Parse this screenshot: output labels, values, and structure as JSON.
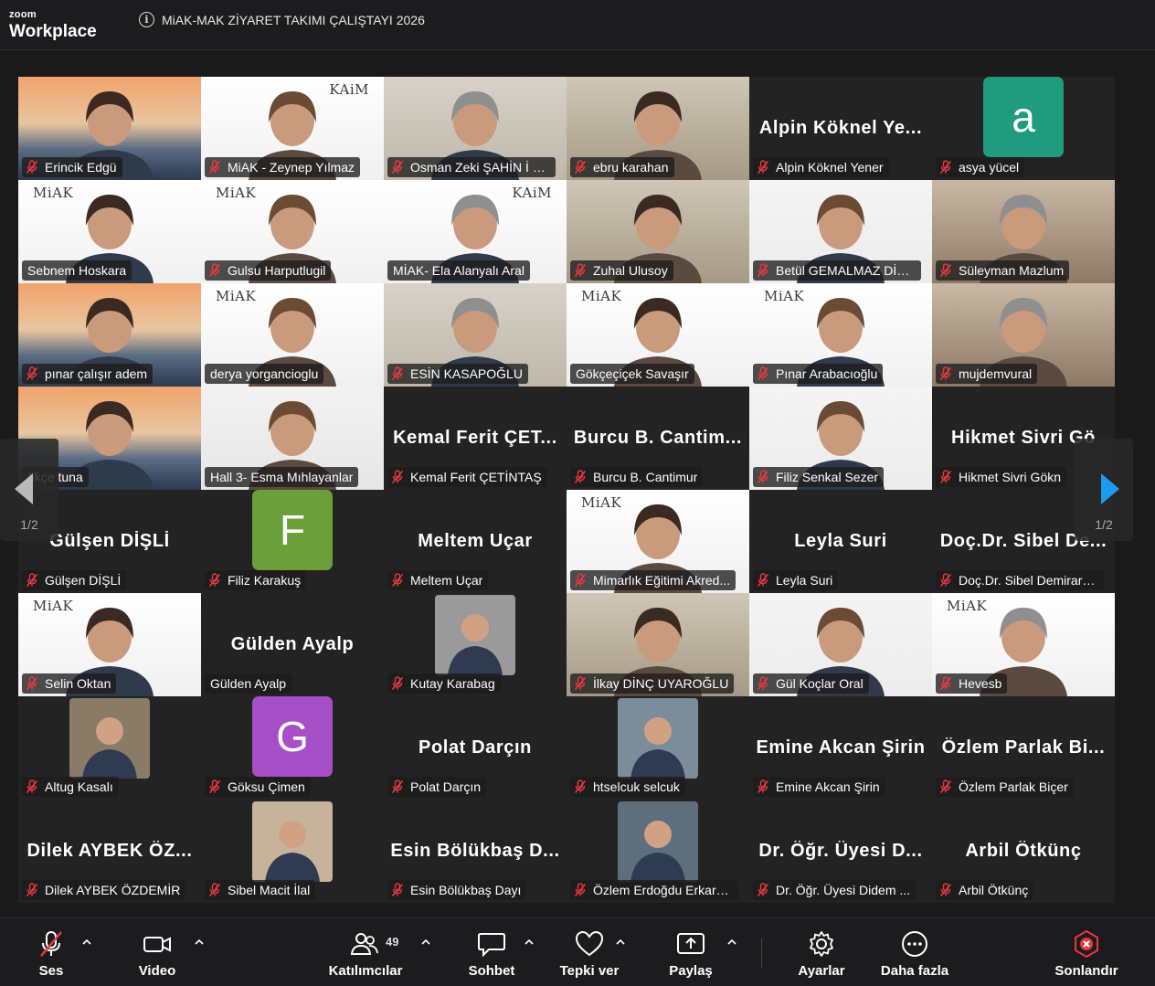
{
  "app": {
    "brand_small": "zoom",
    "brand_name": "Workplace",
    "meeting_title": "MiAK-MAK ZİYARET TAKIMI ÇALIŞTAYI 2026"
  },
  "gallery": {
    "page_indicator_prev": "1/2",
    "page_indicator_next": "1/2",
    "tiles": [
      {
        "label": "Erincik Edgü",
        "muted": true
      },
      {
        "label": "MiAK - Zeynep Yılmaz",
        "muted": true,
        "logo": "KAiM"
      },
      {
        "label": "Osman Zeki ŞAHİN İ B...",
        "muted": true
      },
      {
        "label": "ebru karahan",
        "muted": true
      },
      {
        "label": "Alpin Köknel Yener",
        "muted": true,
        "big": "Alpin Köknel Ye..."
      },
      {
        "label": "asya yücel",
        "muted": true,
        "avatar": "a",
        "avatar_color": "#1f9b7e"
      },
      {
        "label": "Sebnem Hoskara",
        "muted": false,
        "active": true,
        "logo": "MiAK"
      },
      {
        "label": "Gulsu Harputlugil",
        "muted": true,
        "logo": "MiAK"
      },
      {
        "label": "MİAK- Ela Alanyalı Aral",
        "muted": false,
        "logo": "KAiM"
      },
      {
        "label": "Zuhal Ulusoy",
        "muted": true
      },
      {
        "label": "Betül GEMALMAZ DİKİ...",
        "muted": true
      },
      {
        "label": "Süleyman Mazlum",
        "muted": true
      },
      {
        "label": "pınar çalışır adem",
        "muted": true
      },
      {
        "label": "derya yorgancioglu",
        "muted": false,
        "logo": "MiAK"
      },
      {
        "label": "ESİN KASAPOĞLU",
        "muted": true
      },
      {
        "label": "Gökçeçiçek Savaşır",
        "muted": false,
        "logo": "MiAK"
      },
      {
        "label": "Pınar Arabacıoğlu",
        "muted": true,
        "logo": "MiAK"
      },
      {
        "label": "mujdemvural",
        "muted": true
      },
      {
        "label": "ökçe tuna",
        "muted": false
      },
      {
        "label": "Hall 3- Esma Mıhlayanlar",
        "muted": false
      },
      {
        "label": "Kemal Ferit ÇETİNTAŞ",
        "muted": true,
        "big": "Kemal Ferit ÇET..."
      },
      {
        "label": "Burcu B. Cantimur",
        "muted": true,
        "big": "Burcu B. Cantim..."
      },
      {
        "label": "Filiz Senkal Sezer",
        "muted": true
      },
      {
        "label": "Hikmet Sivri Gökn",
        "muted": true,
        "big": "Hikmet Sivri Gö"
      },
      {
        "label": "Gülşen DİŞLİ",
        "muted": true,
        "big": "Gülşen DİŞLİ"
      },
      {
        "label": "Filiz Karakuş",
        "muted": true,
        "avatar": "F",
        "avatar_color": "#6a9f3a"
      },
      {
        "label": "Meltem Uçar",
        "muted": true,
        "big": "Meltem Uçar"
      },
      {
        "label": "Mimarlık Eğitimi Akred...",
        "muted": true,
        "logo": "MiAK"
      },
      {
        "label": "Leyla Suri",
        "muted": true,
        "big": "Leyla Suri"
      },
      {
        "label": "Doç.Dr. Sibel Demirars...",
        "muted": true,
        "big": "Doç.Dr. Sibel De..."
      },
      {
        "label": "Selin Oktan",
        "muted": true,
        "logo": "MiAK"
      },
      {
        "label": "Gülden Ayalp",
        "muted": false,
        "big": "Gülden Ayalp"
      },
      {
        "label": "Kutay Karabag",
        "muted": true,
        "thumb": true
      },
      {
        "label": "İlkay DİNÇ UYAROĞLU",
        "muted": true
      },
      {
        "label": "Gül Koçlar Oral",
        "muted": true
      },
      {
        "label": "Hevesb",
        "muted": true,
        "logo": "MiAK"
      },
      {
        "label": "Altug Kasalı",
        "muted": true,
        "thumb": true
      },
      {
        "label": "Göksu Çimen",
        "muted": true,
        "avatar": "G",
        "avatar_color": "#a64fc6"
      },
      {
        "label": "Polat Darçın",
        "muted": true,
        "big": "Polat Darçın"
      },
      {
        "label": "htselcuk selcuk",
        "muted": true,
        "thumb": true
      },
      {
        "label": "Emine Akcan Şirin",
        "muted": true,
        "big": "Emine Akcan Şirin"
      },
      {
        "label": "Özlem Parlak Biçer",
        "muted": true,
        "big": "Özlem Parlak Bi..."
      },
      {
        "label": "Dilek AYBEK ÖZDEMİR",
        "muted": true,
        "big": "Dilek AYBEK ÖZ..."
      },
      {
        "label": "Sibel Macit İlal",
        "muted": true,
        "thumb": true
      },
      {
        "label": "Esin Bölükbaş Dayı",
        "muted": true,
        "big": "Esin Bölükbaş D..."
      },
      {
        "label": "Özlem Erdoğdu Erkarsl...",
        "muted": true,
        "thumb": true
      },
      {
        "label": "Dr. Öğr. Üyesi Didem ...",
        "muted": true,
        "big": "Dr. Öğr. Üyesi D..."
      },
      {
        "label": "Arbil Ötkünç",
        "muted": true,
        "big": "Arbil Ötkünç"
      }
    ]
  },
  "toolbar": {
    "audio_label": "Ses",
    "video_label": "Video",
    "participants_label": "Katılımcılar",
    "participants_count": "49",
    "chat_label": "Sohbet",
    "react_label": "Tepki ver",
    "share_label": "Paylaş",
    "settings_label": "Ayarlar",
    "more_label": "Daha fazla",
    "end_label": "Sonlandır"
  },
  "colors": {
    "active_speaker": "#23d18b",
    "muted_icon": "#e8383d",
    "next_arrow": "#1d9bf0",
    "end_button": "#e8383d"
  }
}
